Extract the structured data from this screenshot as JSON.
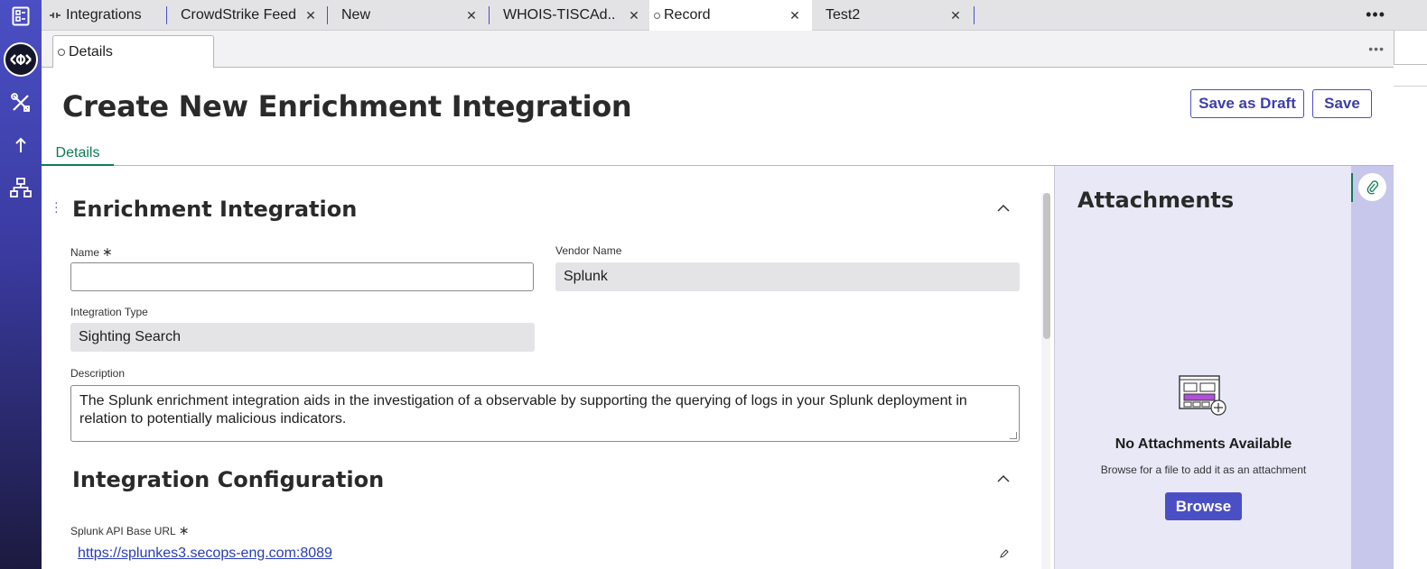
{
  "tabs": [
    {
      "label": "Integrations",
      "icon": "integration-icon"
    },
    {
      "label": "CrowdStrike Feed"
    },
    {
      "label": "New"
    },
    {
      "label": "WHOIS-TISCAd..."
    },
    {
      "label": "Record",
      "active": true
    },
    {
      "label": "Test2"
    }
  ],
  "subtabs": {
    "details": "Details"
  },
  "header": {
    "title": "Create New Enrichment Integration",
    "save_draft": "Save as Draft",
    "save": "Save",
    "tab_details": "Details"
  },
  "section1": {
    "title": "Enrichment Integration",
    "name_label": "Name",
    "name_value": "",
    "vendor_label": "Vendor Name",
    "vendor_value": "Splunk",
    "type_label": "Integration Type",
    "type_value": "Sighting Search",
    "desc_label": "Description",
    "desc_value": "The Splunk enrichment integration aids in the investigation of a observable by supporting the querying of logs in your Splunk deployment in relation to potentially malicious indicators."
  },
  "section2": {
    "title": "Integration Configuration",
    "url_label": "Splunk API Base URL",
    "url_value": "https://splunkes3.secops-eng.com:8089"
  },
  "attachments": {
    "title": "Attachments",
    "empty": "No Attachments Available",
    "hint": "Browse for a file to add it as an attachment",
    "browse": "Browse"
  },
  "colors": {
    "brand": "#4b4fc4",
    "accent_green": "#0e7a55",
    "link": "#2a3cb5"
  }
}
